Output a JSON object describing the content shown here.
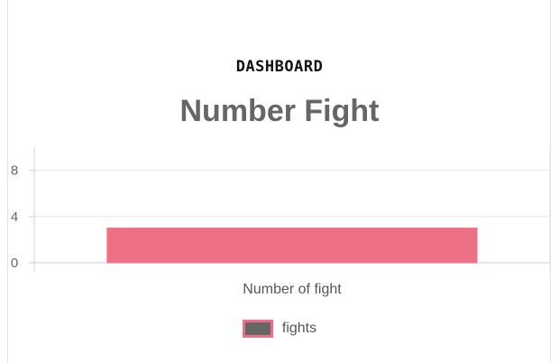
{
  "header": {
    "eyebrow": "DASHBOARD",
    "title": "Number Fight"
  },
  "colors": {
    "bar_fill": "#ee7084",
    "bar_border": "#ec6f83",
    "legend_swatch": "#666666",
    "grid": "#e6e6e6",
    "text": "#666666"
  },
  "chart_data": {
    "type": "bar",
    "title": "Number Fight",
    "categories": [
      "Number of fight"
    ],
    "series": [
      {
        "name": "fights",
        "values": [
          3
        ]
      }
    ],
    "xlabel": "",
    "ylabel": "",
    "ylim": [
      0,
      10
    ],
    "yticks": [
      "0",
      "4",
      "8"
    ],
    "grid": true,
    "legend": "bottom"
  }
}
